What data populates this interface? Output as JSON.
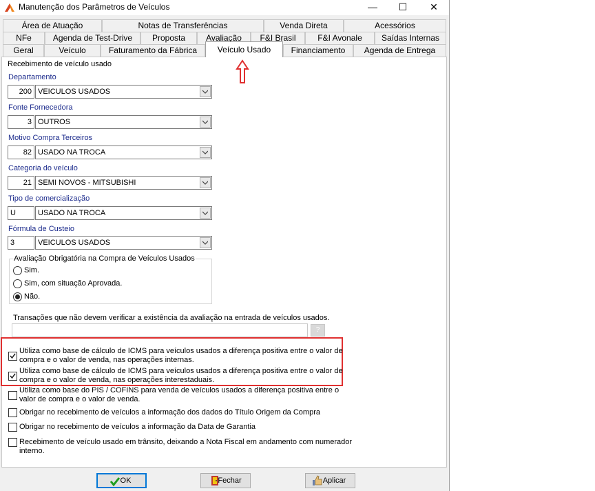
{
  "window": {
    "title": "Manutenção dos Parâmetros de Veículos",
    "controls": {
      "minimize": "—",
      "maximize": "☐",
      "close": "✕"
    }
  },
  "tabs": {
    "row1": [
      "Área de Atuação",
      "Notas de Transferências",
      "Venda Direta",
      "Acessórios"
    ],
    "row2": [
      "NFe",
      "Agenda de Test-Drive",
      "Proposta",
      "Avaliação",
      "F&I Brasil",
      "F&I Avonale",
      "Saídas Internas"
    ],
    "row3": [
      "Geral",
      "Veículo",
      "Faturamento da Fábrica",
      "Veículo Usado",
      "Financiamento",
      "Agenda de Entrega"
    ],
    "active": "Veículo Usado"
  },
  "section_title": "Recebimento de veículo usado",
  "fields": [
    {
      "label": "Departamento",
      "code": "200",
      "value": "VEICULOS USADOS"
    },
    {
      "label": "Fonte Fornecedora",
      "code": "3",
      "value": "OUTROS"
    },
    {
      "label": "Motivo Compra Terceiros",
      "code": "82",
      "value": "USADO NA TROCA"
    },
    {
      "label": "Categoria do veículo",
      "code": "21",
      "value": "SEMI NOVOS - MITSUBISHI"
    },
    {
      "label": "Tipo de comercialização",
      "code": "U",
      "value": "USADO NA TROCA"
    },
    {
      "label": "Fórmula de Custeio",
      "code": "3",
      "value": "VEICULOS USADOS"
    }
  ],
  "evaluation_group": {
    "title": "Avaliação Obrigatória na Compra de Veículos Usados",
    "options": [
      "Sim.",
      "Sim, com situação Aprovada.",
      "Não."
    ],
    "selected": 2
  },
  "transactions": {
    "label": "Transações que não devem verificar a existência da avaliação na entrada de veículos usados.",
    "value": "",
    "button": "?"
  },
  "checkboxes": [
    {
      "label": "Utiliza como base de cálculo de ICMS para veículos usados a diferença positiva entre o valor de compra e o valor de venda, nas operações internas.",
      "checked": true
    },
    {
      "label": "Utiliza como base de cálculo de ICMS para veículos usados a diferença positiva entre o valor de compra e o valor de venda, nas operações interestaduais.",
      "checked": true
    },
    {
      "label": "Utiliza como base do PIS / COFINS  para venda de veículos usados a diferença positiva entre o valor de compra e o valor de venda.",
      "checked": false
    },
    {
      "label": "Obrigar no recebimento de veículos a informação dos dados do Título Origem da Compra",
      "checked": false
    },
    {
      "label": "Obrigar no recebimento de veículos a informação da Data de Garantia",
      "checked": false
    },
    {
      "label": "Recebimento de veículo usado em trânsito, deixando a Nota Fiscal em andamento com numerador interno.",
      "checked": false
    }
  ],
  "buttons": {
    "ok": "OK",
    "close": "Fechar",
    "apply": "Aplicar"
  },
  "colors": {
    "field_label": "#1c2b8c",
    "highlight": "#e03030",
    "focus": "#0078d7"
  }
}
